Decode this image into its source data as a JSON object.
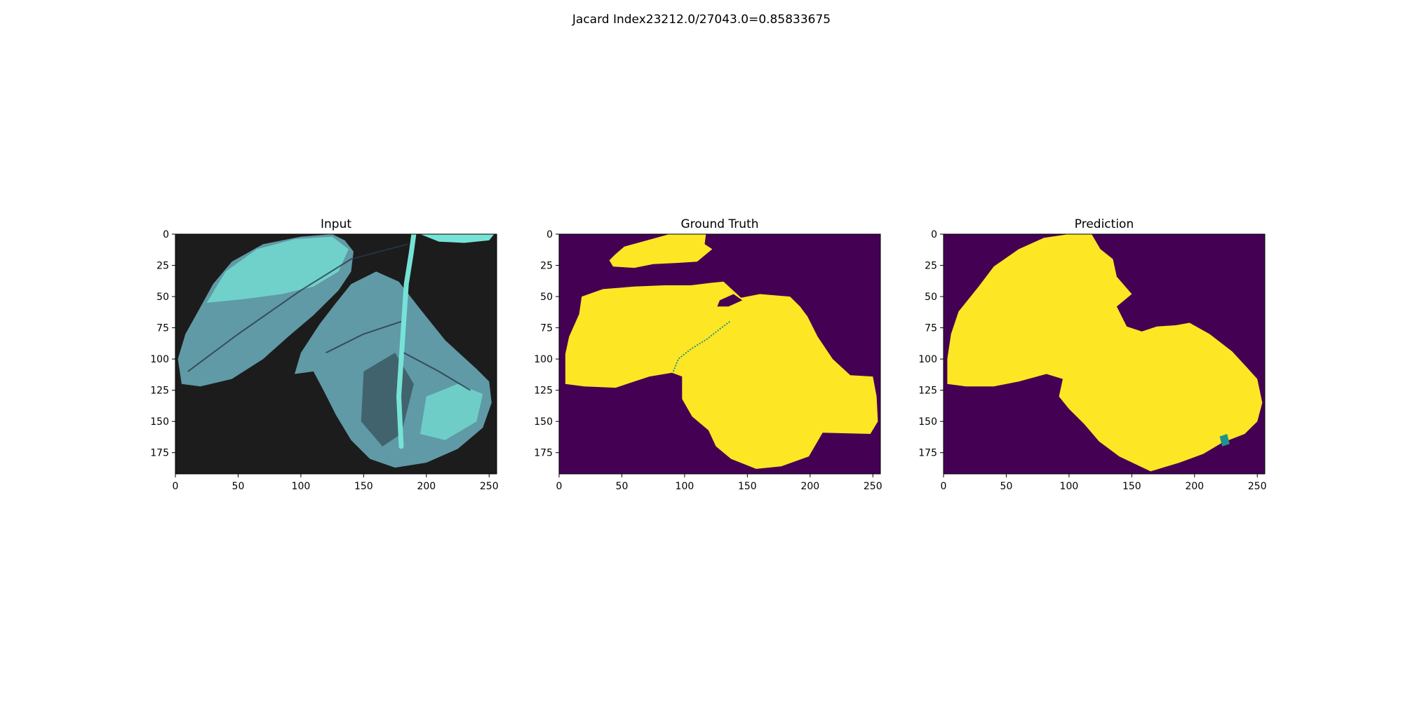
{
  "figure": {
    "suptitle": "Jacard Index23212.0/27043.0=0.85833675"
  },
  "panels": [
    {
      "id": "input",
      "title": "Input",
      "kind": "photo",
      "x_ticks": [
        "0",
        "50",
        "100",
        "150",
        "200",
        "250"
      ],
      "y_ticks": [
        "0",
        "25",
        "50",
        "75",
        "100",
        "125",
        "150",
        "175"
      ]
    },
    {
      "id": "ground-truth",
      "title": "Ground Truth",
      "kind": "mask",
      "x_ticks": [
        "0",
        "50",
        "100",
        "150",
        "200",
        "250"
      ],
      "y_ticks": [
        "0",
        "25",
        "50",
        "75",
        "100",
        "125",
        "150",
        "175"
      ]
    },
    {
      "id": "prediction",
      "title": "Prediction",
      "kind": "mask",
      "x_ticks": [
        "0",
        "50",
        "100",
        "150",
        "200",
        "250"
      ],
      "y_ticks": [
        "0",
        "25",
        "50",
        "75",
        "100",
        "125",
        "150",
        "175"
      ]
    }
  ],
  "colors": {
    "mask_background": "#440154",
    "mask_foreground": "#fde725",
    "mask_boundary": "#21918c",
    "photo_background": "#1c1c1c",
    "leaf_light": "#76e3d6",
    "leaf_mid": "#5f9aa6",
    "leaf_dark": "#3a5560",
    "leaf_vein": "#2a3a45"
  }
}
